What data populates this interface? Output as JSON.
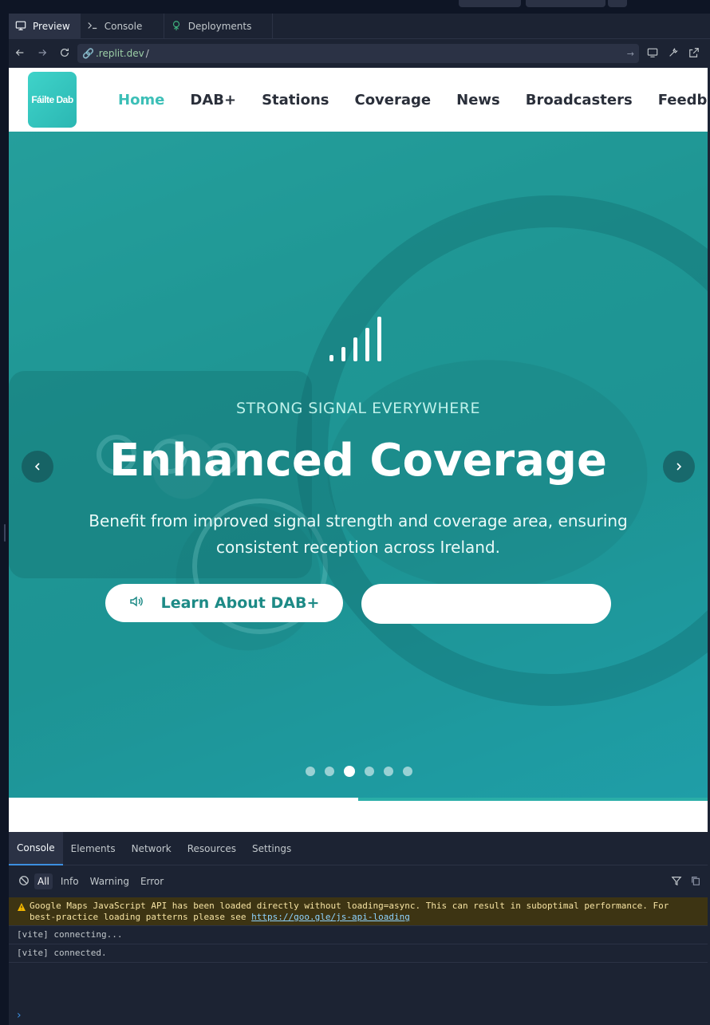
{
  "workspace": {
    "tabs": [
      {
        "label": "Preview",
        "icon": "monitor-icon",
        "active": true
      },
      {
        "label": "Console",
        "icon": "terminal-icon",
        "active": false
      },
      {
        "label": "Deployments",
        "icon": "deploy-icon",
        "active": false
      }
    ],
    "url": {
      "host": ".replit.dev",
      "path": "/"
    }
  },
  "site": {
    "logo_text": "Fáilte Dab",
    "menu": [
      "Home",
      "DAB+",
      "Stations",
      "Coverage",
      "News",
      "Broadcasters",
      "Feedback"
    ],
    "active_menu": "Home"
  },
  "hero": {
    "eyebrow": "STRONG SIGNAL EVERYWHERE",
    "headline": "Enhanced Coverage",
    "subtitle": "Benefit from improved signal strength and coverage area, ensuring consistent reception across Ireland.",
    "primary_button": "Learn About DAB+",
    "secondary_button": "",
    "slide_count": 6,
    "active_slide": 3,
    "progress": 0.5
  },
  "devtools": {
    "tabs": [
      "Console",
      "Elements",
      "Network",
      "Resources",
      "Settings"
    ],
    "active_tab": "Console",
    "levels": [
      "All",
      "Info",
      "Warning",
      "Error"
    ],
    "active_level": "All",
    "logs": [
      {
        "level": "warning",
        "text": "Google Maps JavaScript API has been loaded directly without loading=async. This can result in suboptimal performance. For best-practice loading patterns please see ",
        "link": "https://goo.gle/js-api-loading"
      },
      {
        "level": "log",
        "text": "[vite] connecting..."
      },
      {
        "level": "log",
        "text": "[vite] connected."
      }
    ]
  },
  "colors": {
    "accent": "#3cbfb7",
    "hero_teal": "#1f8f8b",
    "devtools_bg": "#1c2333"
  }
}
